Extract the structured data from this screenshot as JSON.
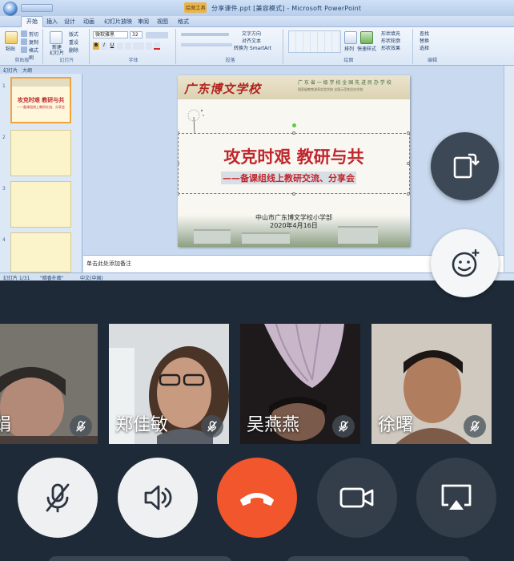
{
  "ppt": {
    "title_tab_label": "绘图工具",
    "window_title": "分享课件.ppt [兼容模式] - Microsoft PowerPoint",
    "ribbon_tabs": [
      "开始",
      "插入",
      "设计",
      "动画",
      "幻灯片放映",
      "审阅",
      "视图",
      "格式"
    ],
    "clipboard": {
      "paste": "粘贴",
      "cut": "剪切",
      "copy": "复制",
      "format_painter": "格式刷",
      "group": "剪贴板"
    },
    "slides_group": {
      "new_slide": "新建\n幻灯片",
      "layout": "版式",
      "reset": "重设",
      "delete": "删除",
      "group": "幻灯片"
    },
    "font": {
      "family": "微软雅黑",
      "size": "32",
      "group": "字体"
    },
    "paragraph": {
      "text_direction": "文字方向",
      "align_text": "对齐文本",
      "smartart": "转换为 SmartArt",
      "group": "段落"
    },
    "drawing": {
      "arrange": "排列",
      "quick_styles": "快速样式",
      "shape_fill": "形状填充",
      "shape_outline": "形状轮廓",
      "shape_effects": "形状效果",
      "group": "绘图"
    },
    "editing": {
      "find": "查找",
      "replace": "替换",
      "select": "选择",
      "group": "编辑"
    },
    "pane_tabs": [
      "幻灯片",
      "大纲"
    ],
    "thumbnails": [
      {
        "num": "1",
        "title": "攻克时艰  教研与共",
        "sub": "——备课组线上教研交流、分享会"
      },
      {
        "num": "2"
      },
      {
        "num": "3"
      },
      {
        "num": "4"
      }
    ],
    "slide": {
      "school_name": "广东博文学校",
      "header_small_1": "广 东 省 一 级 学 校    全 国 先 进 民 办 学 校",
      "header_small_2": "国家级教育改革实验学校  全国示范性民办学校",
      "main_title": "攻克时艰  教研与共",
      "subtitle": "——备课组线上教研交流、分享会",
      "org": "中山市广东博文学校小学部",
      "date": "2020年4月16日"
    },
    "notes_placeholder": "单击此处添加备注",
    "status": {
      "slide_count": "幻灯片 1/31",
      "theme": "\"暗香扑面\"",
      "language": "中文(中国)"
    }
  },
  "participants": [
    {
      "name": "娟",
      "muted": true,
      "skin": "#b38a78"
    },
    {
      "name": "郑佳敏",
      "muted": true,
      "skin": "#c89a80"
    },
    {
      "name": "吴燕燕",
      "muted": true,
      "skin": "#7a5a4a"
    },
    {
      "name": "徐曙",
      "muted": true,
      "skin": "#b07e5e"
    }
  ],
  "controls": {
    "mic": "mic-off",
    "speaker": "speaker-on",
    "hangup": "hang-up",
    "camera": "camera",
    "share": "screen-share"
  },
  "floating": {
    "rotate": "rotate-screen",
    "emoji": "emoji-reaction"
  },
  "colors": {
    "hangup_red": "#f1562c",
    "dark_button": "#343e4b",
    "light_button": "#eef0f2",
    "slide_title_red": "#c0262c"
  }
}
